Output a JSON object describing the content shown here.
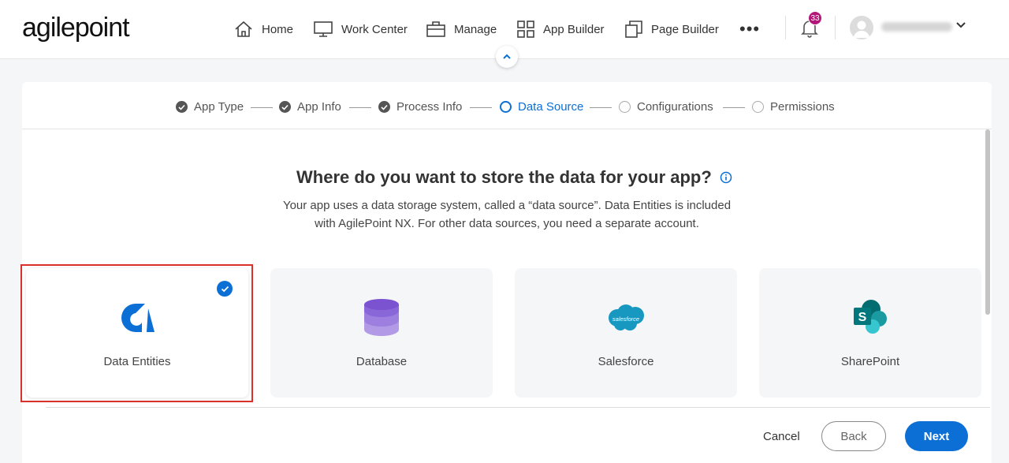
{
  "header": {
    "logo_text": "agilepoint",
    "nav": [
      {
        "label": "Home",
        "icon": "home-icon"
      },
      {
        "label": "Work Center",
        "icon": "monitor-icon"
      },
      {
        "label": "Manage",
        "icon": "briefcase-icon"
      },
      {
        "label": "App Builder",
        "icon": "grid-icon"
      },
      {
        "label": "Page Builder",
        "icon": "pages-icon"
      }
    ],
    "more_label": "•••",
    "notification_count": "33",
    "colors": {
      "badge": "#b3177a",
      "accent": "#0b6fd6"
    }
  },
  "stepper": {
    "steps": [
      {
        "label": "App Type",
        "state": "done"
      },
      {
        "label": "App Info",
        "state": "done"
      },
      {
        "label": "Process Info",
        "state": "done"
      },
      {
        "label": "Data Source",
        "state": "current"
      },
      {
        "label": "Configurations",
        "state": "todo"
      },
      {
        "label": "Permissions",
        "state": "todo"
      }
    ]
  },
  "main": {
    "question": "Where do you want to store the data for your app?",
    "description_line1": "Your app uses a data storage system, called a “data source”. Data Entities is included",
    "description_line2": "with AgilePoint NX. For other data sources, you need a separate account.",
    "tiles": [
      {
        "label": "Data Entities",
        "icon": "data-entities-icon",
        "selected": true
      },
      {
        "label": "Database",
        "icon": "database-icon",
        "selected": false
      },
      {
        "label": "Salesforce",
        "icon": "salesforce-icon",
        "selected": false,
        "icon_text": "salesforce"
      },
      {
        "label": "SharePoint",
        "icon": "sharepoint-icon",
        "selected": false,
        "icon_text": "S"
      }
    ]
  },
  "footer": {
    "cancel_label": "Cancel",
    "back_label": "Back",
    "next_label": "Next"
  }
}
